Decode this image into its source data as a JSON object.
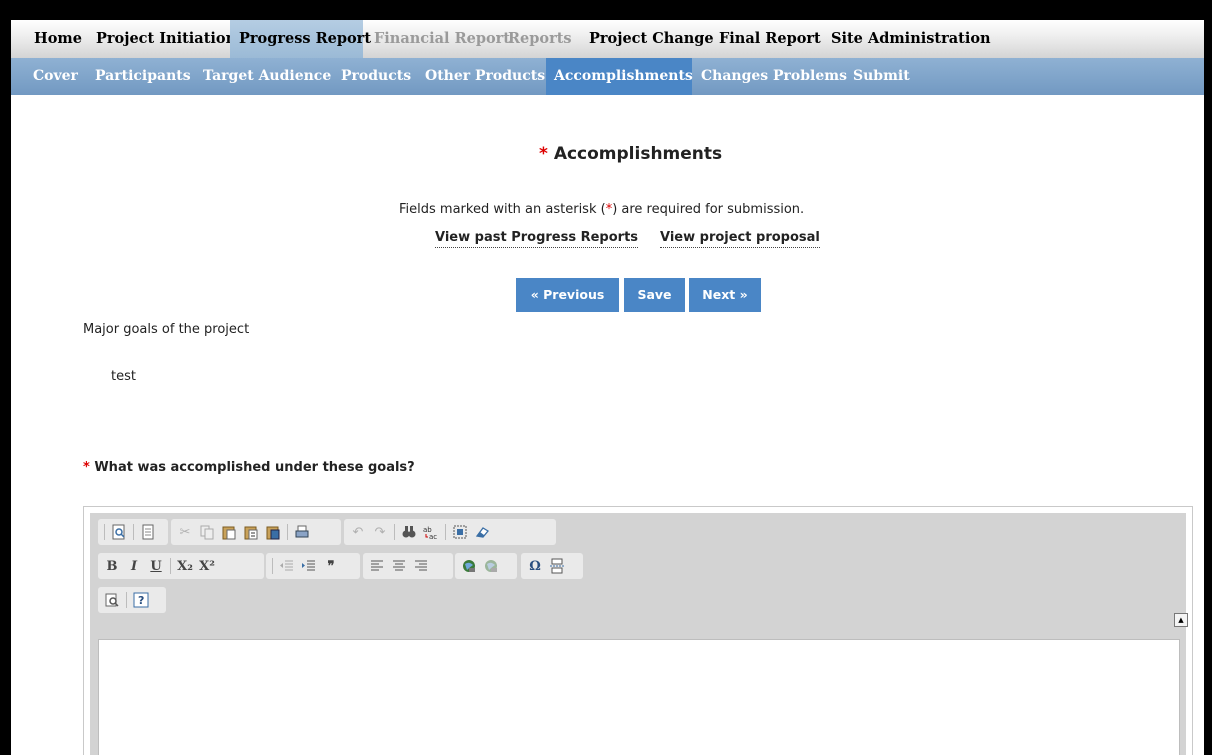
{
  "topnav": [
    {
      "label": "Home",
      "state": "normal"
    },
    {
      "label": "Project Initiation",
      "state": "normal"
    },
    {
      "label": "Progress Report",
      "state": "active"
    },
    {
      "label": "Financial Report",
      "state": "disabled"
    },
    {
      "label": "Reports",
      "state": "disabled"
    },
    {
      "label": "Project Change",
      "state": "normal"
    },
    {
      "label": "Final Report",
      "state": "normal"
    },
    {
      "label": "Site Administration",
      "state": "normal"
    }
  ],
  "subnav": [
    {
      "label": "Cover",
      "state": "normal"
    },
    {
      "label": "Participants",
      "state": "normal"
    },
    {
      "label": "Target Audience",
      "state": "normal"
    },
    {
      "label": "Products",
      "state": "normal"
    },
    {
      "label": "Other Products",
      "state": "normal"
    },
    {
      "label": "Accomplishments",
      "state": "active"
    },
    {
      "label": "Changes Problems",
      "state": "normal"
    },
    {
      "label": "Submit",
      "state": "normal"
    }
  ],
  "page": {
    "required_mark": "*",
    "title": "Accomplishments",
    "note_before": "Fields marked with an asterisk (",
    "note_mark": "*",
    "note_after": ") are required for submission.",
    "link_past": "View past Progress Reports",
    "link_proposal": "View project proposal",
    "btn_previous": "« Previous",
    "btn_save": "Save",
    "btn_next": "Next »",
    "goals_label": "Major goals of the project",
    "goals_value": "test",
    "question_mark": "*",
    "question": "What was accomplished under these goals?"
  },
  "editor": {
    "bold": "B",
    "italic": "I",
    "underline": "U",
    "subscript": "X₂",
    "superscript": "X²",
    "blockquote": "❞",
    "special_char": "Ω",
    "help": "?",
    "collapse": "▲"
  },
  "colors": {
    "accent": "#4a86c6",
    "subnav": "#7fa5cc",
    "required": "#d00000"
  }
}
